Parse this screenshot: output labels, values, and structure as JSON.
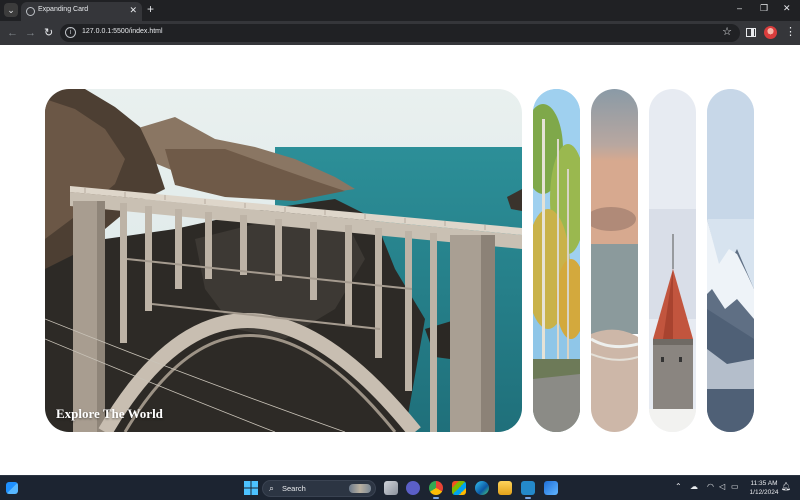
{
  "browser": {
    "tab": {
      "title": "Expanding Card"
    },
    "address_bar": {
      "url": "127.0.0.1:5500/index.html"
    },
    "window_controls": {
      "minimize": "–",
      "restore": "❐",
      "close": "✕"
    }
  },
  "page": {
    "panels": [
      {
        "title": "Explore The World",
        "scene": "big-sur-bridge",
        "active": true
      },
      {
        "title": "",
        "scene": "birch-forest",
        "active": false
      },
      {
        "title": "",
        "scene": "beach-sunset",
        "active": false
      },
      {
        "title": "",
        "scene": "castle-tower",
        "active": false
      },
      {
        "title": "",
        "scene": "snowy-mountain",
        "active": false
      }
    ]
  },
  "taskbar": {
    "search_placeholder": "Search",
    "apps": [
      "start-icon",
      "search",
      "task-view-icon",
      "meet-icon",
      "chrome-icon",
      "store-icon",
      "edge-icon",
      "file-explorer-icon",
      "vscode-icon",
      "photos-icon"
    ],
    "clock": {
      "time": "11:35 AM",
      "date": "1/12/2024"
    }
  },
  "colors": {
    "tabstrip": "#202124",
    "toolbar": "#35363a",
    "taskbar": "#1c2431",
    "sea": "#2f8f9a"
  }
}
